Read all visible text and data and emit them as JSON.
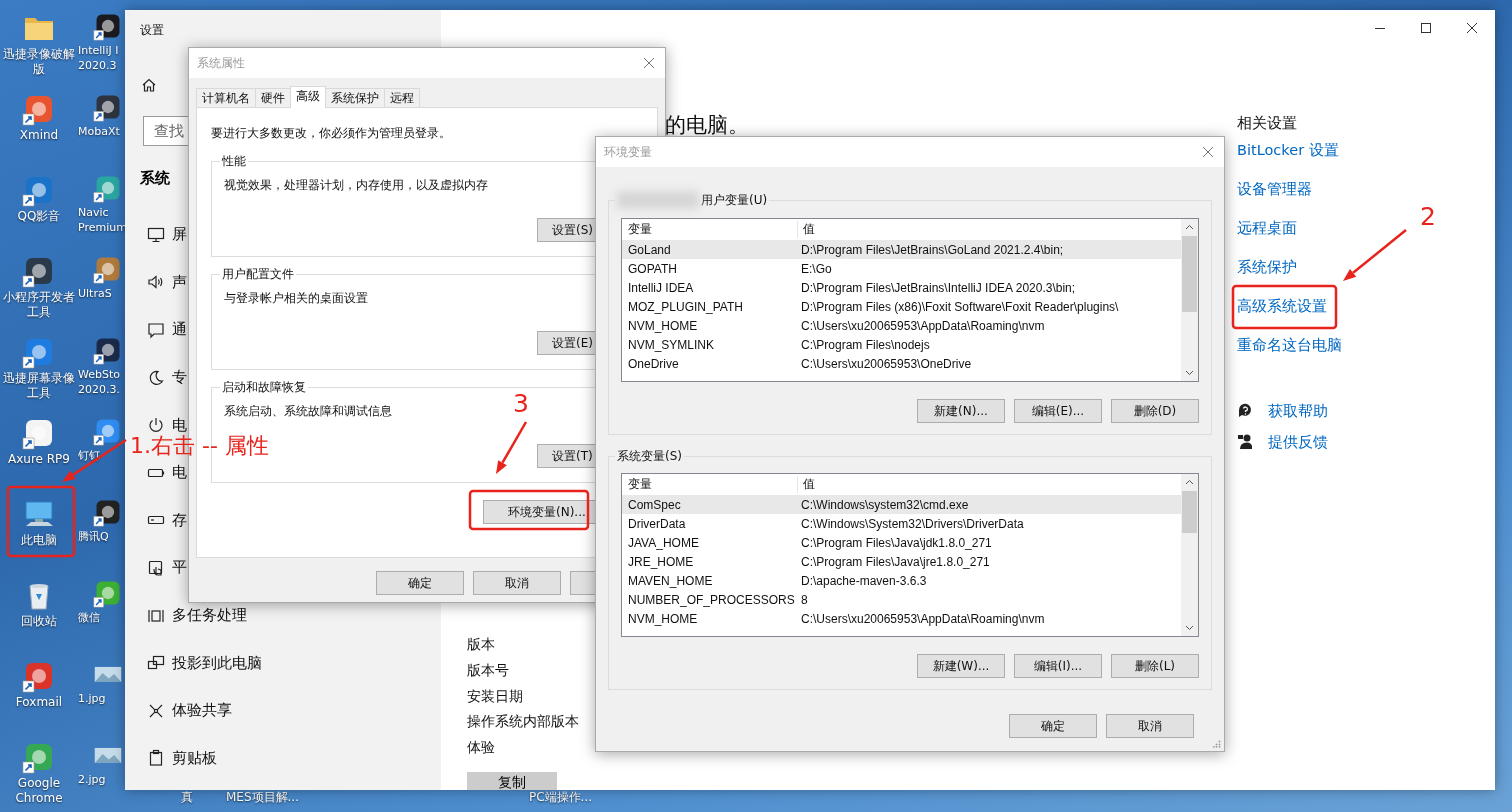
{
  "desktop": {
    "icons": [
      {
        "label": "迅捷录像破解版",
        "kind": "folder",
        "shortcut": false
      },
      {
        "label": "Xmind",
        "kind": "app",
        "color": "#e8542f",
        "shortcut": true
      },
      {
        "label": "QQ影音",
        "kind": "app",
        "color": "#1a73c9",
        "shortcut": true
      },
      {
        "label": "小程序开发者工具",
        "kind": "app",
        "color": "#2b3a4a",
        "shortcut": true
      },
      {
        "label": "迅捷屏幕录像工具",
        "kind": "app",
        "color": "#1e7be0",
        "shortcut": true
      },
      {
        "label": "Axure RP9",
        "kind": "app",
        "color": "#f4f4f4",
        "shortcut": true
      },
      {
        "label": "此电脑",
        "kind": "computer",
        "shortcut": false
      },
      {
        "label": "回收站",
        "kind": "trash",
        "shortcut": false
      },
      {
        "label": "Foxmail",
        "kind": "app",
        "color": "#d9332a",
        "shortcut": true
      },
      {
        "label": "Google Chrome",
        "kind": "app",
        "color": "#34a853",
        "shortcut": true
      }
    ],
    "icons_column_2": [
      {
        "label": "IntelliJ I\n2020.3",
        "kind": "app",
        "color": "#1b1b1f",
        "shortcut": true
      },
      {
        "label": "MobaXt",
        "kind": "app",
        "color": "#2d3440",
        "shortcut": true
      },
      {
        "label": "Navic\nPremium",
        "kind": "app",
        "color": "#2aa6a0",
        "shortcut": true
      },
      {
        "label": "UltraS",
        "kind": "app",
        "color": "#b07a3c",
        "shortcut": true
      },
      {
        "label": "WebSto\n2020.3.",
        "kind": "app",
        "color": "#1b2a4a",
        "shortcut": true
      },
      {
        "label": "钉钉",
        "kind": "app",
        "color": "#2f8cf0",
        "shortcut": true
      },
      {
        "label": "腾讯Q",
        "kind": "app",
        "color": "#222222",
        "shortcut": true
      },
      {
        "label": "微信",
        "kind": "app",
        "color": "#3cb034",
        "shortcut": true
      },
      {
        "label": "1.jpg",
        "kind": "image",
        "shortcut": false
      },
      {
        "label": "2.jpg",
        "kind": "image",
        "shortcut": false
      }
    ],
    "peeking_labels": [
      "真",
      "MES项目解...",
      "PC端操作..."
    ]
  },
  "settings": {
    "title": "设置",
    "search": {
      "placeholder": "查找"
    },
    "heading": "系统",
    "nav": [
      {
        "label": "屏"
      },
      {
        "label": "声"
      },
      {
        "label": "通"
      },
      {
        "label": "专"
      },
      {
        "label": "电"
      },
      {
        "label": "电"
      },
      {
        "label": "存"
      },
      {
        "label": "平"
      },
      {
        "label": "多任务处理"
      },
      {
        "label": "投影到此电脑"
      },
      {
        "label": "体验共享"
      },
      {
        "label": "剪贴板"
      }
    ],
    "page_heading": "的电脑。",
    "specs": [
      "版本",
      "版本号",
      "安装日期",
      "操作系统内部版本",
      "体验"
    ],
    "copy_button": "复制",
    "related": {
      "title": "相关设置",
      "links": [
        "BitLocker 设置",
        "设备管理器",
        "远程桌面",
        "系统保护",
        "高级系统设置",
        "重命名这台电脑"
      ]
    },
    "help": [
      {
        "label": "获取帮助"
      },
      {
        "label": "提供反馈"
      }
    ]
  },
  "system_properties": {
    "title": "系统属性",
    "tabs": [
      {
        "label": "计算机名",
        "selected": false
      },
      {
        "label": "硬件",
        "selected": false
      },
      {
        "label": "高级",
        "selected": true
      },
      {
        "label": "系统保护",
        "selected": false
      },
      {
        "label": "远程",
        "selected": false
      }
    ],
    "notice": "要进行大多数更改，你必须作为管理员登录。",
    "groups": [
      {
        "title": "性能",
        "text": "视觉效果，处理器计划，内存使用，以及虚拟内存",
        "button": "设置(S)"
      },
      {
        "title": "用户配置文件",
        "text": "与登录帐户相关的桌面设置",
        "button": "设置(E)"
      },
      {
        "title": "启动和故障恢复",
        "text": "系统启动、系统故障和调试信息",
        "button": "设置(T)"
      }
    ],
    "env_button": "环境变量(N)...",
    "buttons": [
      "确定",
      "取消"
    ]
  },
  "environment_variables": {
    "title": "环境变量",
    "sections": [
      {
        "label": "用户变量(U)",
        "blurred_prefix": true,
        "columns": [
          "变量",
          "值"
        ],
        "rows": [
          {
            "name": "GoLand",
            "value": "D:\\Program Files\\JetBrains\\GoLand 2021.2.4\\bin;",
            "selected": true
          },
          {
            "name": "GOPATH",
            "value": "E:\\Go",
            "selected": false
          },
          {
            "name": "IntelliJ IDEA",
            "value": "D:\\Program Files\\JetBrains\\IntelliJ IDEA 2020.3\\bin;",
            "selected": false
          },
          {
            "name": "MOZ_PLUGIN_PATH",
            "value": "D:\\Program Files (x86)\\Foxit Software\\Foxit Reader\\plugins\\",
            "selected": false
          },
          {
            "name": "NVM_HOME",
            "value": "C:\\Users\\xu20065953\\AppData\\Roaming\\nvm",
            "selected": false
          },
          {
            "name": "NVM_SYMLINK",
            "value": "C:\\Program Files\\nodejs",
            "selected": false
          },
          {
            "name": "OneDrive",
            "value": "C:\\Users\\xu20065953\\OneDrive",
            "selected": false
          }
        ],
        "buttons": [
          "新建(N)...",
          "编辑(E)...",
          "删除(D)"
        ]
      },
      {
        "label": "系统变量(S)",
        "blurred_prefix": false,
        "columns": [
          "变量",
          "值"
        ],
        "rows": [
          {
            "name": "ComSpec",
            "value": "C:\\Windows\\system32\\cmd.exe",
            "selected": true
          },
          {
            "name": "DriverData",
            "value": "C:\\Windows\\System32\\Drivers\\DriverData",
            "selected": false
          },
          {
            "name": "JAVA_HOME",
            "value": "C:\\Program Files\\Java\\jdk1.8.0_271",
            "selected": false
          },
          {
            "name": "JRE_HOME",
            "value": "C:\\Program Files\\Java\\jre1.8.0_271",
            "selected": false
          },
          {
            "name": "MAVEN_HOME",
            "value": "D:\\apache-maven-3.6.3",
            "selected": false
          },
          {
            "name": "NUMBER_OF_PROCESSORS",
            "value": "8",
            "selected": false
          },
          {
            "name": "NVM_HOME",
            "value": "C:\\Users\\xu20065953\\AppData\\Roaming\\nvm",
            "selected": false
          }
        ],
        "buttons": [
          "新建(W)...",
          "编辑(I)...",
          "删除(L)"
        ]
      }
    ],
    "buttons": [
      "确定",
      "取消"
    ]
  },
  "annotations": [
    {
      "text": "1.右击 -- 属性"
    },
    {
      "text": "2"
    },
    {
      "text": "3"
    }
  ]
}
